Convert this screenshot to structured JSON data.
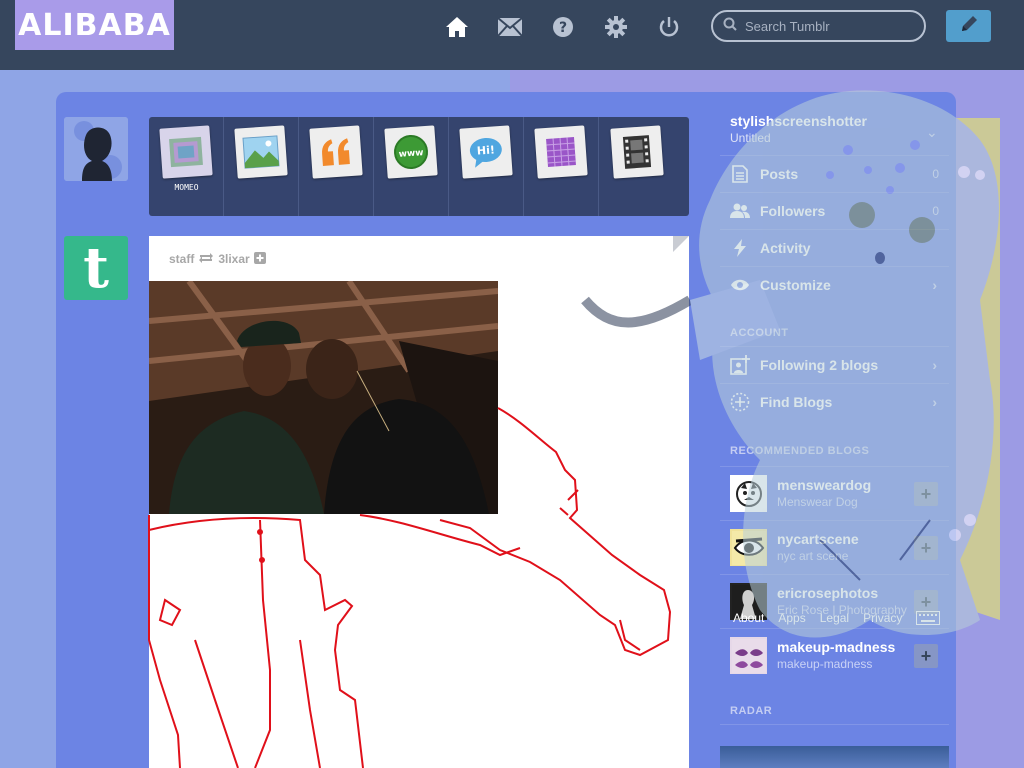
{
  "header": {
    "logo_text": "ALIBABA",
    "search_placeholder": "Search Tumblr",
    "nav_icons": [
      "home-icon",
      "mail-icon",
      "help-icon",
      "gear-icon",
      "power-icon"
    ],
    "compose_icon": "pencil-icon"
  },
  "post_types": [
    {
      "name": "text",
      "label": "MOMEO"
    },
    {
      "name": "photo",
      "label": ""
    },
    {
      "name": "quote",
      "label": ""
    },
    {
      "name": "link",
      "label": ""
    },
    {
      "name": "chat",
      "label": ""
    },
    {
      "name": "audio",
      "label": ""
    },
    {
      "name": "video",
      "label": ""
    }
  ],
  "post": {
    "author": "staff",
    "reblogged_from": "3lixar"
  },
  "sidebar": {
    "blog_name": "stylishscreenshotter",
    "blog_subtitle": "Untitled",
    "items": [
      {
        "label": "Posts",
        "count": "0"
      },
      {
        "label": "Followers",
        "count": "0"
      },
      {
        "label": "Activity",
        "count": ""
      },
      {
        "label": "Customize",
        "count": ""
      }
    ],
    "account_heading": "ACCOUNT",
    "account_items": [
      {
        "label": "Following 2 blogs"
      },
      {
        "label": "Find Blogs"
      }
    ],
    "recommended_heading": "RECOMMENDED BLOGS",
    "recommended": [
      {
        "name": "mensweardog",
        "desc": "Menswear Dog"
      },
      {
        "name": "nycartscene",
        "desc": "nyc art scene"
      },
      {
        "name": "ericrosephotos",
        "desc": "Eric Rose | Photography"
      },
      {
        "name": "makeup-madness",
        "desc": "makeup-madness"
      }
    ],
    "footer_links": [
      "About",
      "Apps",
      "Legal",
      "Privacy"
    ],
    "radar_heading": "RADAR"
  },
  "colors": {
    "header": "#36465d",
    "container": "#6c84e4",
    "accent": "#529ecc",
    "staff_avatar": "#35b88b",
    "sketch_red": "#e0101a"
  }
}
